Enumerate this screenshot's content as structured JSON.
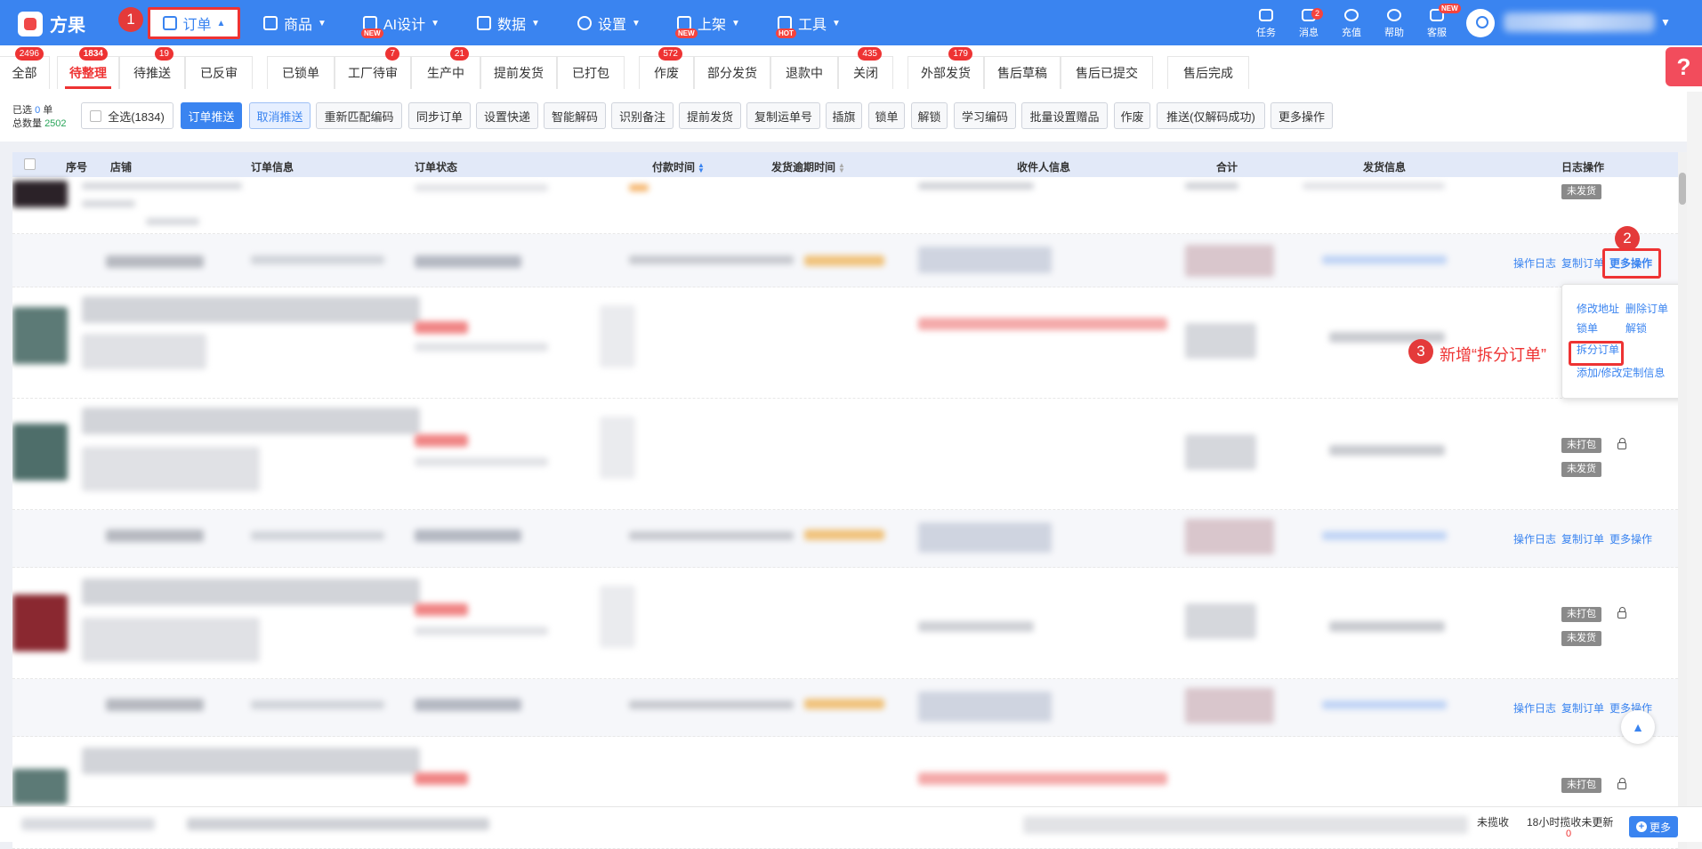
{
  "app": {
    "name": "方果"
  },
  "nav": {
    "order": "订单",
    "goods": "商品",
    "ai": "AI设计",
    "data": "数据",
    "settings": "设置",
    "listing": "上架",
    "tools": "工具",
    "new_badge": "NEW",
    "hot_badge": "HOT"
  },
  "toptools": [
    {
      "label": "任务",
      "icon": "task-icon"
    },
    {
      "label": "消息",
      "icon": "message-icon",
      "count": "2"
    },
    {
      "label": "充值",
      "icon": "recharge-icon"
    },
    {
      "label": "帮助",
      "icon": "help-icon"
    },
    {
      "label": "客服",
      "icon": "service-icon",
      "badge": "NEW"
    }
  ],
  "annotations": {
    "step1": "1",
    "step2": "2",
    "step3": "3",
    "step3_text": "新增“拆分订单”"
  },
  "tabs": [
    {
      "label": "全部",
      "count": "2496"
    },
    {
      "label": "待整理",
      "count": "1834",
      "active": true
    },
    {
      "label": "待推送",
      "count": "19"
    },
    {
      "label": "已反审"
    },
    {
      "label": "已锁单"
    },
    {
      "label": "工厂待审",
      "count": "7"
    },
    {
      "label": "生产中",
      "count": "21"
    },
    {
      "label": "提前发货"
    },
    {
      "label": "已打包"
    },
    {
      "label": "作废",
      "count": "572"
    },
    {
      "label": "部分发货"
    },
    {
      "label": "退款中"
    },
    {
      "label": "关闭",
      "count": "435"
    },
    {
      "label": "外部发货",
      "count": "179"
    },
    {
      "label": "售后草稿"
    },
    {
      "label": "售后已提交"
    },
    {
      "label": "售后完成"
    }
  ],
  "selection": {
    "selected_prefix": "已选",
    "selected_count": "0",
    "selected_suffix": "单",
    "total_prefix": "总数量",
    "total_count": "2502"
  },
  "toolbar": {
    "select_all": "全选(1834)",
    "buttons": [
      "订单推送",
      "取消推送",
      "重新匹配编码",
      "同步订单",
      "设置快递",
      "智能解码",
      "识别备注",
      "提前发货",
      "复制运单号",
      "插旗",
      "锁单",
      "解锁",
      "学习编码",
      "批量设置赠品",
      "作废",
      "推送(仅解码成功)",
      "更多操作"
    ]
  },
  "table": {
    "headers": [
      "序号",
      "店铺",
      "订单信息",
      "订单状态",
      "付款时间",
      "发货逾期时间",
      "收件人信息",
      "合计",
      "发货信息",
      "日志操作"
    ]
  },
  "row_actions": {
    "log": "操作日志",
    "copy": "复制订单",
    "more": "更多操作"
  },
  "status_tags": {
    "unshipped": "未发货",
    "unpacked": "未打包"
  },
  "popup_menu": {
    "edit_address": "修改地址",
    "delete_order": "删除订单",
    "lock": "锁单",
    "unlock": "解锁",
    "split_order": "拆分订单",
    "custom_info": "添加/修改定制信息"
  },
  "bottom": {
    "label1": "未揽收",
    "label2": "18小时揽收未更新",
    "value2": "0",
    "more": "更多"
  },
  "colors": {
    "primary": "#3a84f0",
    "accent_red": "#e33",
    "success": "#2aa55a"
  }
}
